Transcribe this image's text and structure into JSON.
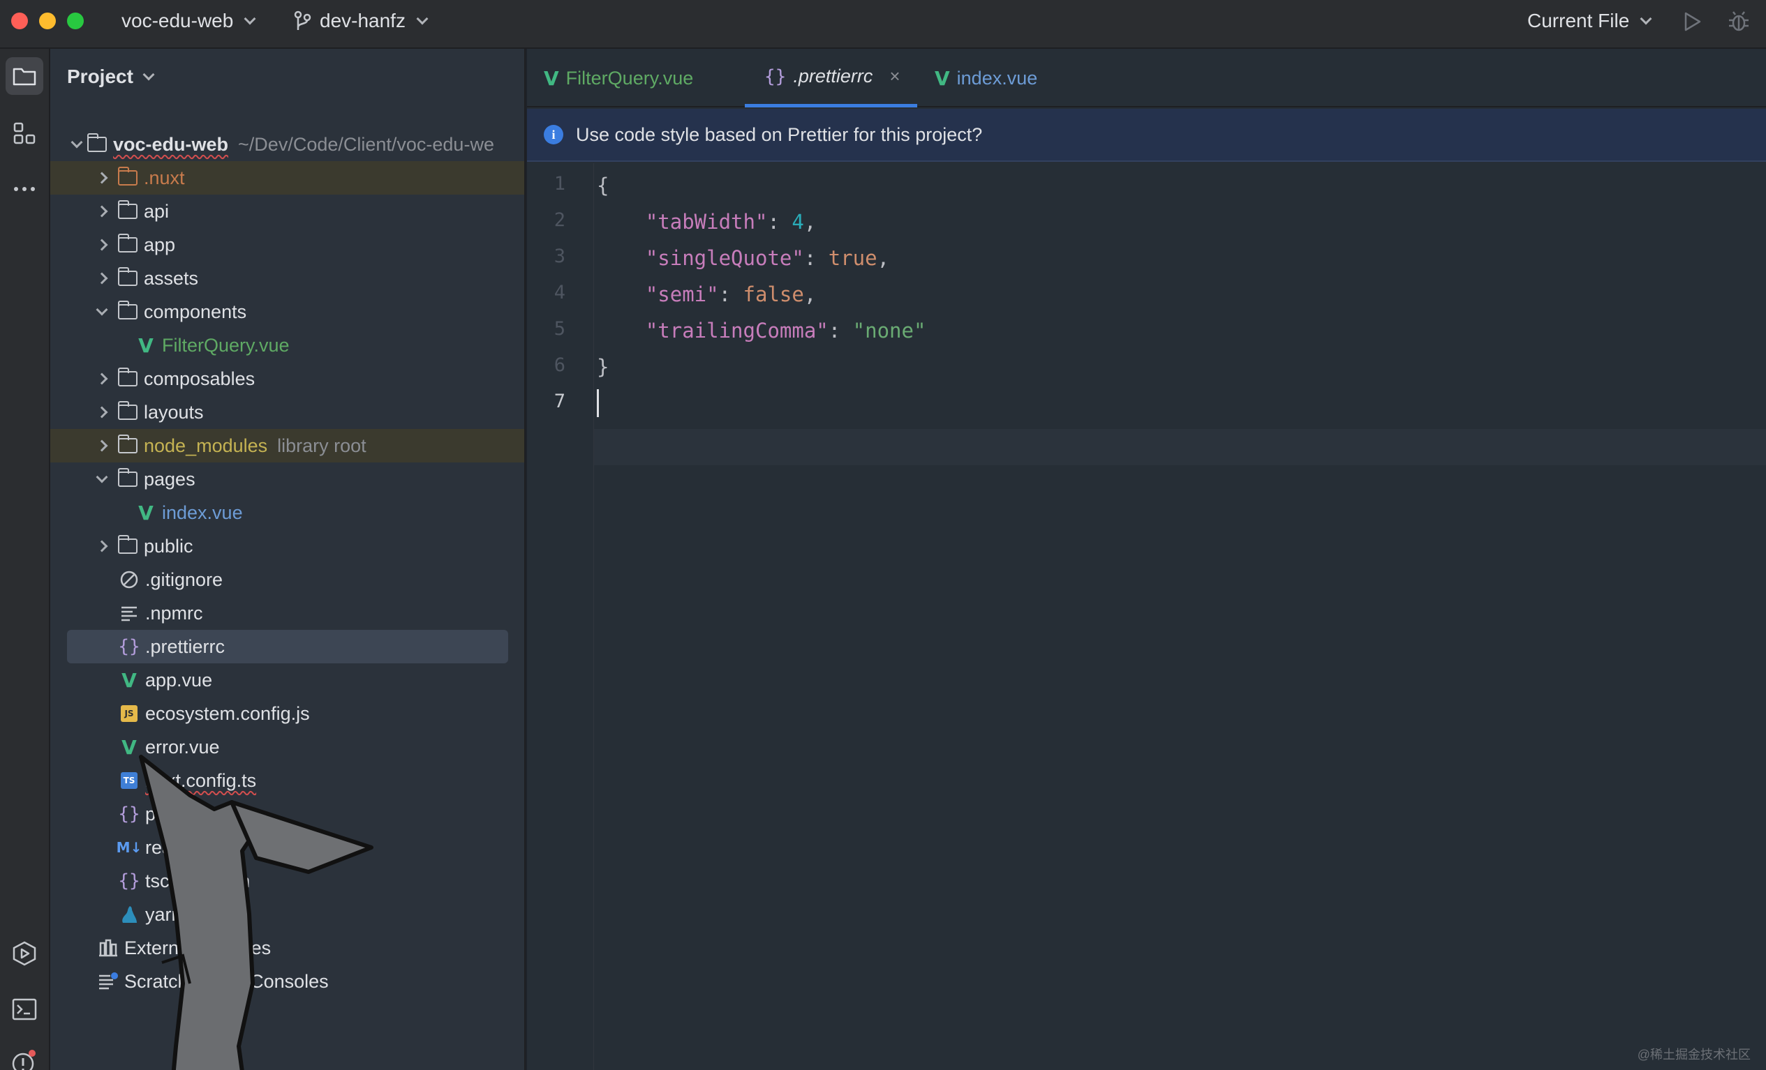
{
  "titlebar": {
    "project_name": "voc-edu-web",
    "branch": "dev-hanfz",
    "run_config": "Current File"
  },
  "project_panel": {
    "title": "Project",
    "root": {
      "name": "voc-edu-web",
      "path": "~/Dev/Code/Client/voc-edu-we"
    },
    "items": [
      {
        "label": ".nuxt",
        "type": "folder",
        "state": "collapsed"
      },
      {
        "label": "api",
        "type": "folder",
        "state": "collapsed"
      },
      {
        "label": "app",
        "type": "folder",
        "state": "collapsed"
      },
      {
        "label": "assets",
        "type": "folder",
        "state": "collapsed"
      },
      {
        "label": "components",
        "type": "folder",
        "state": "expanded"
      },
      {
        "label": "FilterQuery.vue",
        "type": "vue"
      },
      {
        "label": "composables",
        "type": "folder",
        "state": "collapsed"
      },
      {
        "label": "layouts",
        "type": "folder",
        "state": "collapsed"
      },
      {
        "label": "node_modules",
        "type": "folder",
        "state": "collapsed",
        "hint": "library root"
      },
      {
        "label": "pages",
        "type": "folder",
        "state": "expanded"
      },
      {
        "label": "index.vue",
        "type": "vue"
      },
      {
        "label": "public",
        "type": "folder",
        "state": "collapsed"
      },
      {
        "label": ".gitignore",
        "type": "ignore"
      },
      {
        "label": ".npmrc",
        "type": "text"
      },
      {
        "label": ".prettierrc",
        "type": "json",
        "selected": true
      },
      {
        "label": "app.vue",
        "type": "vue"
      },
      {
        "label": "ecosystem.config.js",
        "type": "js"
      },
      {
        "label": "error.vue",
        "type": "vue"
      },
      {
        "label": "nuxt.config.ts",
        "type": "ts"
      },
      {
        "label": "package.json",
        "type": "json"
      },
      {
        "label": "readme.md",
        "type": "md"
      },
      {
        "label": "tsconfig.json",
        "type": "json"
      },
      {
        "label": "yarn.lock",
        "type": "yarn"
      }
    ],
    "external_libraries": "External Libraries",
    "scratches": "Scratches and Consoles"
  },
  "editor": {
    "tabs": [
      {
        "label": "FilterQuery.vue"
      },
      {
        "label": ".prettierrc",
        "active": true,
        "close": "×"
      },
      {
        "label": "index.vue"
      }
    ],
    "banner": "Use code style based on Prettier for this project?",
    "line_numbers": [
      "1",
      "2",
      "3",
      "4",
      "5",
      "6",
      "7"
    ],
    "code": {
      "open_brace": "{",
      "close_brace": "}",
      "entries": [
        {
          "key": "\"tabWidth\"",
          "value": "4",
          "kind": "num",
          "trail": ","
        },
        {
          "key": "\"singleQuote\"",
          "value": "true",
          "kind": "bool",
          "trail": ","
        },
        {
          "key": "\"semi\"",
          "value": "false",
          "kind": "bool",
          "trail": ","
        },
        {
          "key": "\"trailingComma\"",
          "value": "\"none\"",
          "kind": "str",
          "trail": ""
        }
      ]
    }
  },
  "watermark": "@稀土掘金技术社区",
  "colors": {
    "accent": "#3b7de0",
    "vue": "#41b883",
    "string": "#6aab73",
    "key": "#c77dbb",
    "number": "#2aacb8",
    "keyword": "#cf8e6d"
  }
}
